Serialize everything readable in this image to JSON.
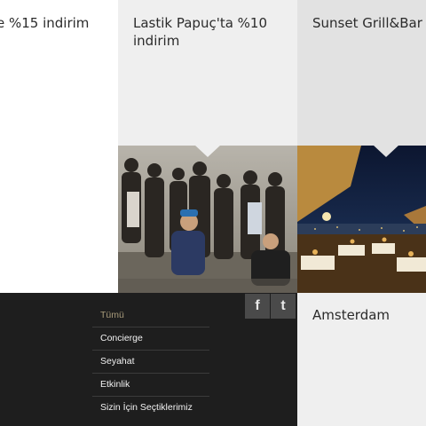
{
  "tiles": [
    {
      "title": "e %15 indirim"
    },
    {
      "title_line1": "Lastik Papuç'ta %10",
      "title_line2": "indirim"
    },
    {
      "title": "Sunset Grill&Bar"
    },
    {
      "title": "Amsterdam"
    }
  ],
  "social": {
    "facebook_glyph": "f",
    "twitter_glyph": "t"
  },
  "menu": {
    "items": [
      "Tümü",
      "Concierge",
      "Seyahat",
      "Etkinlik",
      "Sizin İçin Seçtiklerimiz"
    ],
    "active_index": 0
  },
  "colors": {
    "footer_bg": "#1e1e1e",
    "active_menu": "#a79a7a",
    "tile_light": "#efefef",
    "tile_mid": "#e2e2e2",
    "social_bg": "#4a4a4a"
  },
  "icons": [
    "facebook-icon",
    "twitter-icon"
  ]
}
